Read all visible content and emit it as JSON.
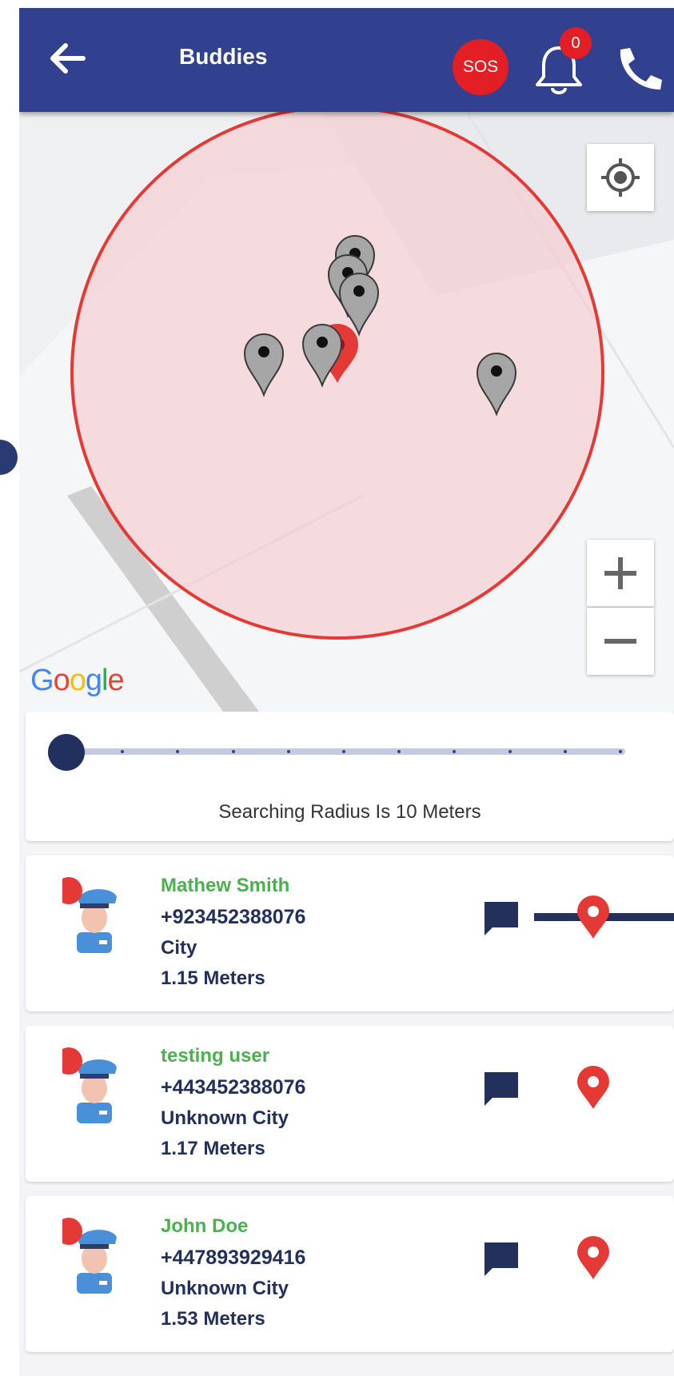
{
  "appbar": {
    "title": "Buddies",
    "sos_label": "SOS",
    "notification_count": "0",
    "icons": {
      "back": "arrow-left-icon",
      "notifications": "bell-icon",
      "call": "phone-icon"
    }
  },
  "map": {
    "attribution": "Google",
    "controls": {
      "my_location": "crosshair-icon",
      "zoom_in": "+",
      "zoom_out": "−"
    },
    "radius_circle_color": "#e53935",
    "marker_colors": {
      "self": "#e53935",
      "buddy": "#9e9e9e"
    }
  },
  "radius": {
    "label": "Searching Radius Is 10 Meters",
    "value_fraction": 0.0,
    "tick_count": 10
  },
  "buddies": [
    {
      "name": "Mathew Smith",
      "phone": "+923452388076",
      "city": "City",
      "distance": "1.15 Meters"
    },
    {
      "name": "testing user",
      "phone": "+443452388076",
      "city": "Unknown City",
      "distance": "1.17 Meters"
    },
    {
      "name": "John Doe",
      "phone": "+447893929416",
      "city": "Unknown City",
      "distance": "1.53 Meters"
    }
  ],
  "colors": {
    "appbar": "#324090",
    "sos": "#e31e24",
    "buddy_name": "#4caf50",
    "buddy_text": "#23305c",
    "marker_icon": "#e53935"
  }
}
